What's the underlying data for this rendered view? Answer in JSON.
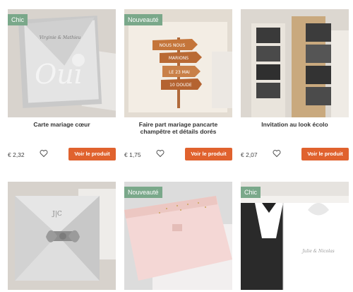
{
  "products": [
    {
      "badge": "Chic",
      "title": "Carte mariage cœur",
      "price": "€ 2,32",
      "button": "Voir le produit"
    },
    {
      "badge": "Nouveauté",
      "title": "Faire part mariage pancarte champêtre et détails dorés",
      "price": "€ 1,75",
      "button": "Voir le produit"
    },
    {
      "badge": "",
      "title": "Invitation au look écolo",
      "price": "€ 2,07",
      "button": "Voir le produit"
    },
    {
      "badge": "",
      "title": "",
      "price": "",
      "button": ""
    },
    {
      "badge": "Nouveauté",
      "title": "",
      "price": "",
      "button": ""
    },
    {
      "badge": "Chic",
      "title": "",
      "price": "",
      "button": ""
    }
  ],
  "card_texts": {
    "oui_script": "Oui",
    "couple_names": "Virginie & Mathieu",
    "signpost_top": "NOUS NOUS",
    "signpost_1": "MARIONS",
    "signpost_2": "LE 23 MAI",
    "signpost_3": "10 DOUDE",
    "monogram": "J|C",
    "names_script": "Julie & Nicolas"
  },
  "colors": {
    "badge_green": "#7aa88a",
    "button_orange": "#e0622e"
  },
  "icons": [
    "heart-outline-icon"
  ]
}
